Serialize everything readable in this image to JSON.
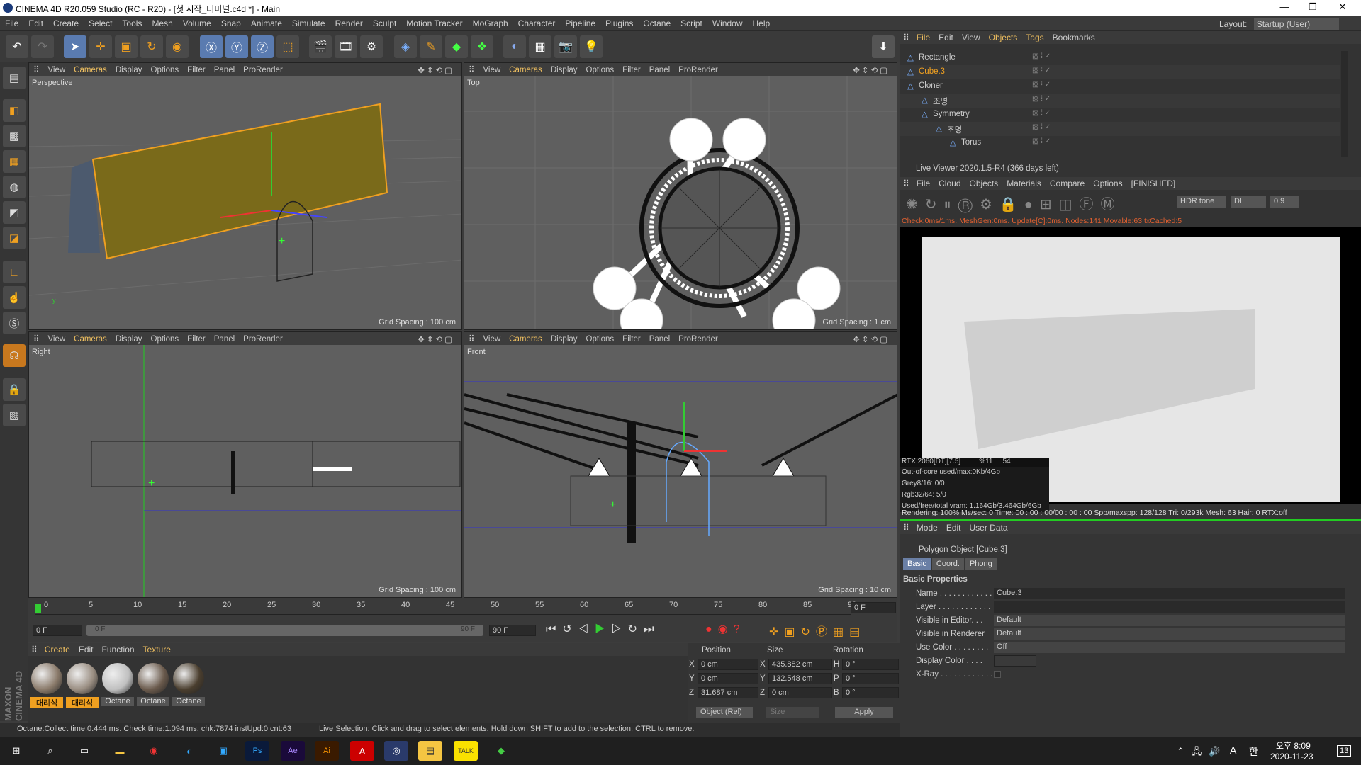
{
  "title": "CINEMA 4D R20.059 Studio (RC - R20) - [첫 시작_터미널.c4d *] - Main",
  "menus": [
    "File",
    "Edit",
    "Create",
    "Select",
    "Tools",
    "Mesh",
    "Volume",
    "Snap",
    "Animate",
    "Simulate",
    "Render",
    "Sculpt",
    "Motion Tracker",
    "MoGraph",
    "Character",
    "Pipeline",
    "Plugins",
    "Octane",
    "Script",
    "Window",
    "Help"
  ],
  "layout_label": "Layout:",
  "layout_value": "Startup (User)",
  "vp_menu": [
    "View",
    "Cameras",
    "Display",
    "Options",
    "Filter",
    "Panel",
    "ProRender"
  ],
  "viewports": [
    {
      "name": "Perspective",
      "grid": "Grid Spacing : 100 cm"
    },
    {
      "name": "Top",
      "grid": "Grid Spacing : 1 cm"
    },
    {
      "name": "Right",
      "grid": "Grid Spacing : 100 cm"
    },
    {
      "name": "Front",
      "grid": "Grid Spacing : 10 cm"
    }
  ],
  "timeline": {
    "ticks": [
      "0",
      "5",
      "10",
      "15",
      "20",
      "25",
      "30",
      "35",
      "40",
      "45",
      "50",
      "55",
      "60",
      "65",
      "70",
      "75",
      "80",
      "85",
      "90"
    ],
    "frame": "0 F",
    "start": "0 F",
    "end_inner": "90 F",
    "end": "90 F",
    "cur": "0 F"
  },
  "matmenu": [
    "Create",
    "Edit",
    "Function",
    "Texture"
  ],
  "materials": [
    "대리석",
    "대리석",
    "Octane",
    "Octane",
    "Octane"
  ],
  "coord": {
    "headers": [
      "Position",
      "Size",
      "Rotation"
    ],
    "rows": [
      {
        "a": "X",
        "p": "0 cm",
        "b": "X",
        "s": "435.882 cm",
        "c": "H",
        "r": "0 °"
      },
      {
        "a": "Y",
        "p": "0 cm",
        "b": "Y",
        "s": "132.548 cm",
        "c": "P",
        "r": "0 °"
      },
      {
        "a": "Z",
        "p": "31.687 cm",
        "b": "Z",
        "s": "0 cm",
        "c": "B",
        "r": "0 °"
      }
    ],
    "mode": "Object (Rel)",
    "size": "Size",
    "apply": "Apply"
  },
  "status_left": "Octane:Collect time:0.444 ms.  Check time:1.094 ms.  chk:7874  instUpd:0  cnt:63",
  "status_right": "Live Selection: Click and drag to select elements. Hold down SHIFT to add to the selection, CTRL to remove.",
  "objmenu": [
    "File",
    "Edit",
    "View",
    "Objects",
    "Tags",
    "Bookmarks"
  ],
  "objects": [
    {
      "n": "Rectangle",
      "d": 0,
      "hl": false
    },
    {
      "n": "Cube.3",
      "d": 0,
      "hl": true
    },
    {
      "n": "Cloner",
      "d": 0,
      "hl": false
    },
    {
      "n": "조명",
      "d": 1,
      "hl": false
    },
    {
      "n": "Symmetry",
      "d": 1,
      "hl": false
    },
    {
      "n": "조명",
      "d": 2,
      "hl": false
    },
    {
      "n": "Torus",
      "d": 3,
      "hl": false
    }
  ],
  "live": {
    "title": "Live Viewer 2020.1.5-R4 (366 days left)",
    "menu": [
      "File",
      "Cloud",
      "Objects",
      "Materials",
      "Compare",
      "Options"
    ],
    "finished": "[FINISHED]",
    "hdr": "HDR tone",
    "dl": "DL",
    "val": "0.9",
    "info": "Check:0ms/1ms. MeshGen:0ms. Update[C]:0ms. Nodes:141 Movable:63 txCached:5",
    "stats": [
      "RTX 2060[DT][7.5]",
      "%11",
      "54"
    ],
    "mem": [
      "Out-of-core used/max:0Kb/4Gb",
      "Grey8/16: 0/0",
      "Rgb32/64: 5/0",
      "Used/free/total vram: 1.164Gb/3.464Gb/6Gb"
    ],
    "render": "Rendering: 100% Ms/sec: 0   Time: 00 : 00 : 00/00 : 00 : 00      Spp/maxspp: 128/128   Tri: 0/293k   Mesh: 63    Hair: 0    RTX:off"
  },
  "attr": {
    "menu": [
      "Mode",
      "Edit",
      "User Data"
    ],
    "title": "Polygon Object [Cube.3]",
    "tabs": [
      "Basic",
      "Coord.",
      "Phong"
    ],
    "section": "Basic Properties",
    "rows": [
      {
        "l": "Name . . . . . . . . . . . .",
        "v": "Cube.3"
      },
      {
        "l": "Layer . . . . . . . . . . . .",
        "v": ""
      },
      {
        "l": "Visible in Editor. . .",
        "v": "Default"
      },
      {
        "l": "Visible in Renderer",
        "v": "Default"
      },
      {
        "l": "Use Color . . . . . . . .",
        "v": "Off"
      },
      {
        "l": "Display Color . . . .",
        "v": ""
      },
      {
        "l": "X-Ray . . . . . . . . . . . .",
        "v": ""
      }
    ]
  },
  "clock": {
    "time": "오후 8:09",
    "date": "2020-11-23",
    "notif": "13"
  },
  "ime": "A",
  "ime2": "한"
}
